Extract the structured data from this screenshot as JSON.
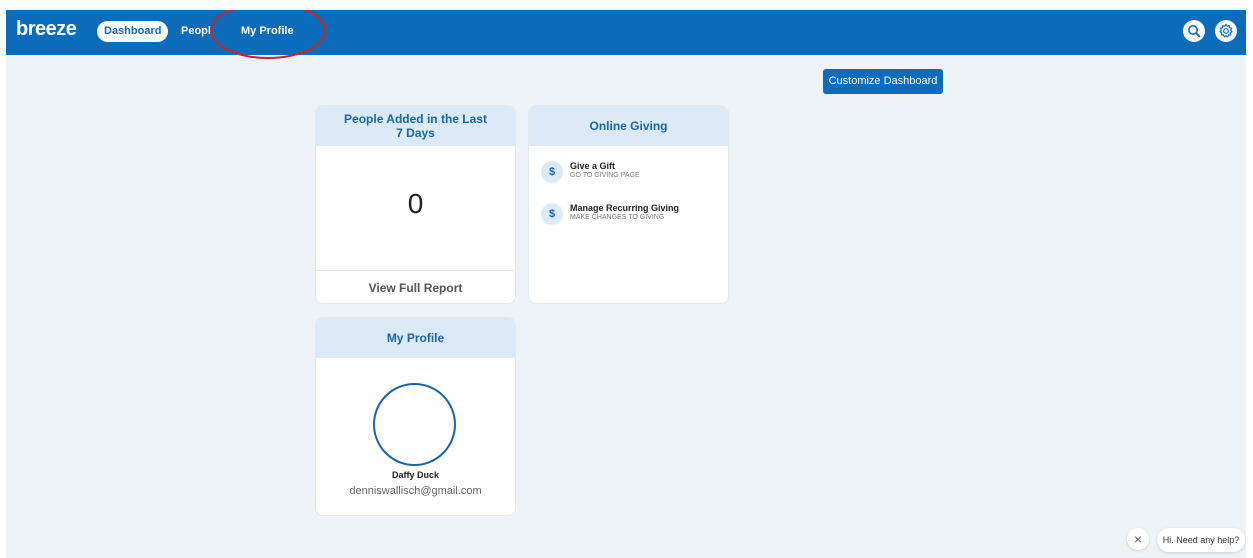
{
  "app": {
    "logo": "breeze",
    "colors": {
      "brand": "#0a6cba",
      "header_tint": "#dceaf8",
      "annotation": "#d42020"
    }
  },
  "nav": {
    "dashboard": "Dashboard",
    "people": "People",
    "my_profile": "My Profile",
    "icons": [
      "search-icon",
      "gear-icon"
    ]
  },
  "toolbar": {
    "customize": "Customize Dashboard"
  },
  "people_card": {
    "title_line1": "People Added in the Last",
    "title_line2": "7 Days",
    "count": "0",
    "footer": "View Full Report"
  },
  "giving_card": {
    "title": "Online Giving",
    "items": [
      {
        "icon": "$",
        "title": "Give a Gift",
        "subtitle": "GO TO GIVING PAGE"
      },
      {
        "icon": "$",
        "title": "Manage Recurring Giving",
        "subtitle": "MAKE CHANGES TO GIVING"
      }
    ]
  },
  "profile_card": {
    "title": "My Profile",
    "name": "Daffy Duck",
    "email": "denniswallisch@gmail.com"
  },
  "help": {
    "close": "×",
    "message": "Hi. Need any help?"
  }
}
